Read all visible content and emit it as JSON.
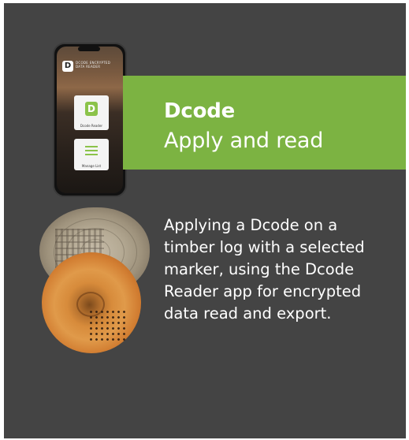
{
  "colors": {
    "card": "#444444",
    "accent": "#7cb342",
    "text": "#ffffff"
  },
  "band": {
    "title": "Dcode",
    "subtitle": "Apply and read"
  },
  "description": "Applying a Dcode on a\ntimber log with a selected\nmarker, using the Dcode\nReader app for encrypted\ndata read and export.",
  "phone": {
    "app_title": "DCODE ENCRYPTED\nDATA READER",
    "logo_letter": "D",
    "tile_reader_letter": "D",
    "tile_reader_label": "Dcode Reader",
    "tile_list_label": "Manage List"
  }
}
